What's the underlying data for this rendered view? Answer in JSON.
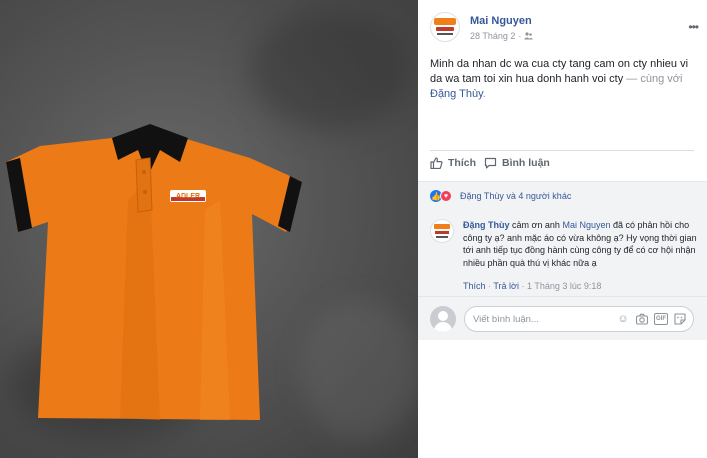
{
  "post": {
    "author": "Mai Nguyen",
    "date": "28 Tháng 2",
    "more_icon": "ellipsis-icon",
    "privacy_icon": "friends-icon",
    "text_main": "Minh da nhan dc wa cua cty tang cam on cty nhieu vi da wa tam toi xin hua donh hanh voi cty",
    "text_with": "— cùng với",
    "tagged": "Đặng Thùy",
    "text_end": "."
  },
  "actions": {
    "like_label": "Thích",
    "comment_label": "Bình luận"
  },
  "reactions": {
    "summary": "Đặng Thùy và 4 người khác"
  },
  "comment": {
    "author": "Đặng Thùy",
    "text_before": "cảm ơn anh",
    "mention": "Mai Nguyen",
    "text_after": "đã có phản hồi cho công ty ạ? anh mặc áo có vừa không ạ? Hy vọng thời gian tới anh tiếp tục đồng hành cùng công ty để có cơ hội nhận nhiều phần quà thú vị khác nữa ạ",
    "like": "Thích",
    "reply": "Trả lời",
    "sep": "·",
    "time": "1 Tháng 3 lúc 9:18"
  },
  "composer": {
    "placeholder": "Viết bình luận...",
    "icons": [
      "emoji-icon",
      "camera-icon",
      "gif-icon",
      "sticker-icon"
    ]
  },
  "shirt": {
    "logo_text": "ADLER"
  },
  "colors": {
    "link": "#365899",
    "shirt_orange": "#f07f1a",
    "collar": "#111111"
  }
}
